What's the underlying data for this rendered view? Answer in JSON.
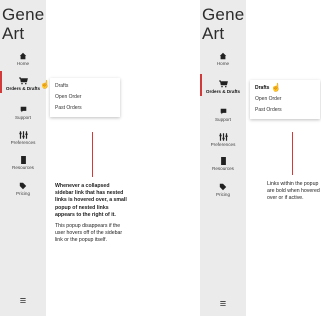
{
  "app": {
    "title_line1": "Gene",
    "title_line2": "Art"
  },
  "sidebar": {
    "items": [
      {
        "icon": "home-icon",
        "glyph": "⌂",
        "label": "Home"
      },
      {
        "icon": "cart-icon",
        "glyph": "🛒",
        "label": "Orders & Drafts"
      },
      {
        "icon": "chat-icon",
        "glyph": "▮",
        "label": "Support"
      },
      {
        "icon": "sliders-icon",
        "glyph": "⫶⫶",
        "label": "Preferences"
      },
      {
        "icon": "book-icon",
        "glyph": "▮",
        "label": "Resources"
      },
      {
        "icon": "tag-icon",
        "glyph": "◆",
        "label": "Pricing"
      }
    ],
    "menu_glyph": "≡"
  },
  "popup": {
    "items": [
      "Drafts",
      "Open Order",
      "Past Orders"
    ]
  },
  "left_panel": {
    "note_bold": "Whenever a collapsed sidebar link that has nested links is hovered over, a small popup of nested links appears to the right of it.",
    "note_plain": "This popup disappears if the user hovers off of the sidebar link or the popup itself."
  },
  "right_panel": {
    "note": "Links within the popup are bold when hovered over or if active."
  }
}
